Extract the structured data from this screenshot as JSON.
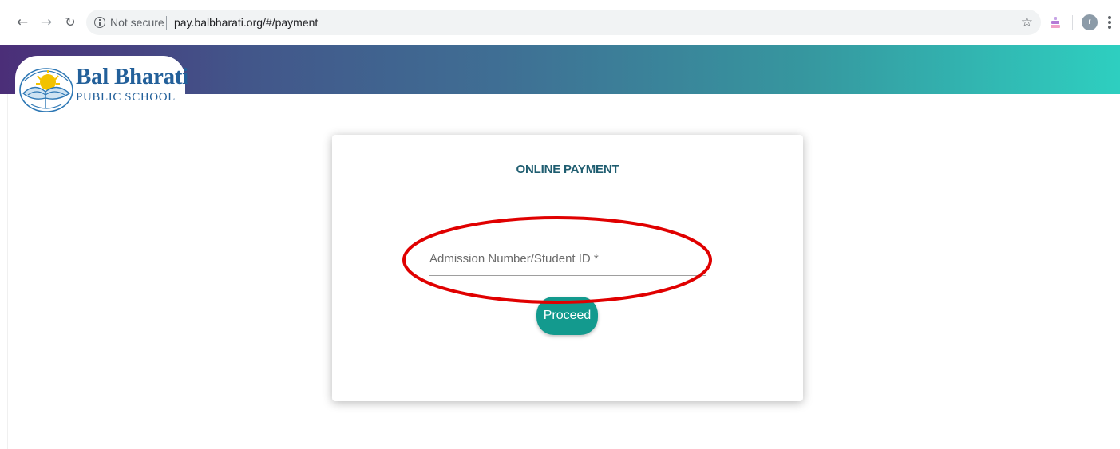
{
  "browser": {
    "security_label": "Not secure",
    "url": "pay.balbharati.org/#/payment",
    "avatar_initial": "r"
  },
  "logo": {
    "name": "Bal Bharati",
    "subtitle": "PUBLIC SCHOOL"
  },
  "payment": {
    "title": "ONLINE PAYMENT",
    "input_placeholder": "Admission Number/Student ID *",
    "proceed_label": "Proceed"
  },
  "colors": {
    "header_gradient_start": "#4b2e78",
    "header_gradient_end": "#2ecfc0",
    "accent_button": "#139a8e",
    "title_text": "#1f5d70",
    "logo_text": "#23609a",
    "annotation_ellipse": "#e00000"
  }
}
